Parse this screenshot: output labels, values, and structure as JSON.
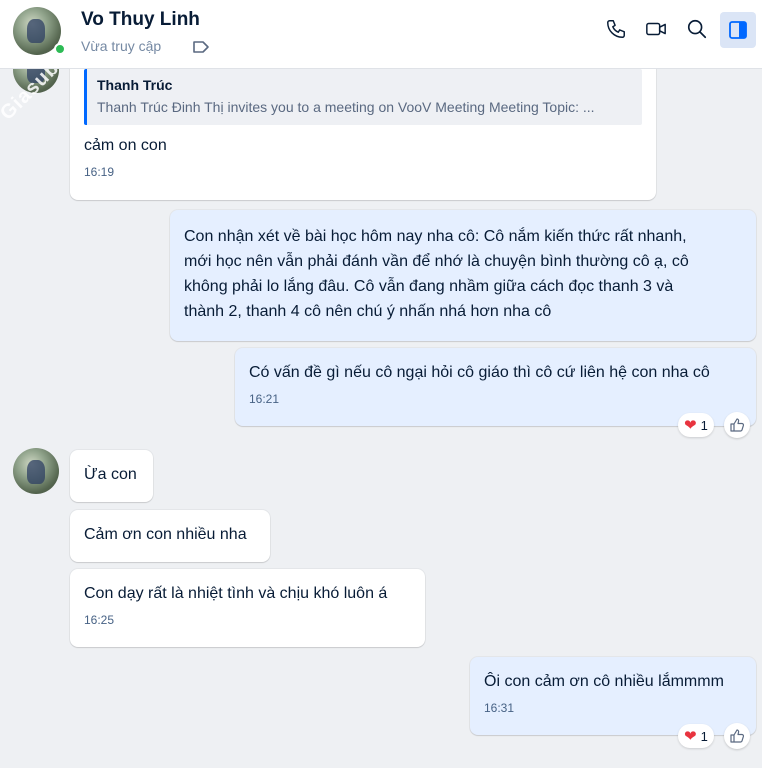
{
  "header": {
    "name": "Vo Thuy Linh",
    "status": "Vừa truy cập"
  },
  "chat": {
    "watermark": "Giasuba",
    "messages": {
      "m1": {
        "quote_name": "Thanh Trúc",
        "quote_text": "Thanh Trúc Đinh Thị invites you to a meeting on VooV Meeting Meeting Topic: ...",
        "text": "cảm on con",
        "time": "16:19"
      },
      "m2": {
        "line1": "Con nhận xét về bài học hôm nay nha cô: Cô nắm kiến thức rất nhanh,",
        "line2": "mới học nên vẫn phải đánh vần để nhớ là chuyện bình thường cô ạ, cô",
        "line3": "không phải lo lắng đâu. Cô vẫn đang nhầm giữa cách đọc thanh 3 và",
        "line4": "thành 2, thanh 4 cô nên chú ý nhấn nhá hơn nha cô"
      },
      "m3": {
        "text": "Có vấn đề gì nếu cô ngại hỏi cô giáo thì cô cứ liên hệ con nha cô",
        "time": "16:21",
        "reaction_count": "1"
      },
      "m4": {
        "text": "Ừa con"
      },
      "m5": {
        "text": "Cảm ơn con nhiều nha"
      },
      "m6": {
        "text": "Con dạy rất là nhiệt tình và chịu khó luôn á",
        "time": "16:25"
      },
      "m7": {
        "text": "Ôi con cảm ơn cô nhiều lắmmmm",
        "time": "16:31",
        "reaction_count": "1"
      }
    }
  },
  "icons": {
    "call": "phone-icon",
    "video": "video-call-icon",
    "search": "search-icon",
    "panel": "sidebar-toggle-icon",
    "tag": "label-tag-icon",
    "reaction": "heart-icon",
    "like": "thumbs-up-icon"
  },
  "colors": {
    "accent": "#0068ff",
    "outgoing_bubble": "#e5efff",
    "incoming_bubble": "#ffffff",
    "online": "#2dbb55",
    "heart": "#e8343f"
  }
}
